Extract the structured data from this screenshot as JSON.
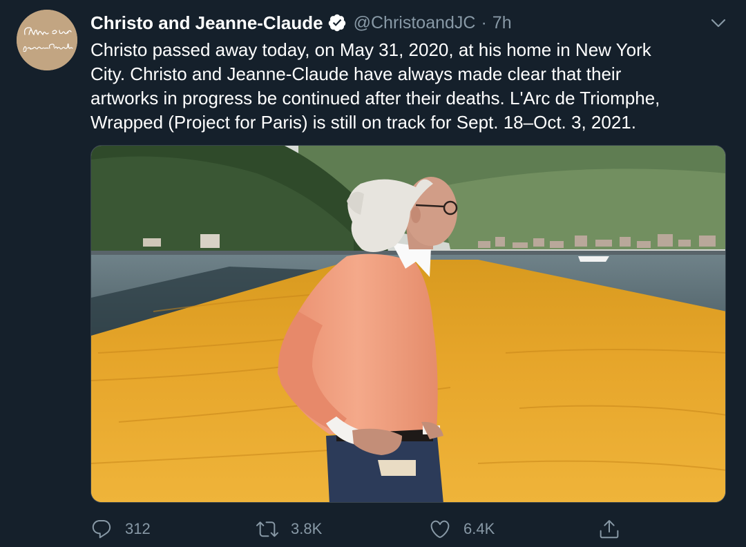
{
  "tweet": {
    "author": {
      "display_name": "Christo and Jeanne-Claude",
      "handle": "@ChristoandJC",
      "verified": true,
      "avatar_signature": "Christo and Jeanne-Claude"
    },
    "separator": "·",
    "timestamp": "7h",
    "text_lines": [
      "Christo passed away today, on May 31, 2020, at his home in New York",
      "City. Christo and Jeanne-Claude have always made clear that their",
      "artworks in progress be continued after their deaths. L'Arc de Triomphe,",
      "Wrapped (Project for Paris) is still on track for Sept. 18–Oct. 3, 2021."
    ],
    "actions": {
      "replies": "312",
      "retweets": "3.8K",
      "likes": "6.4K"
    }
  },
  "colors": {
    "background": "#15202b",
    "secondary_text": "#8899a6",
    "verified_badge": "#ffffff",
    "avatar_background": "#c2a582"
  },
  "icons": {
    "reply": "speech-bubble-icon",
    "retweet": "retweet-arrows-icon",
    "like": "heart-outline-icon",
    "share": "share-upload-icon",
    "menu": "chevron-down-icon",
    "verified": "verified-badge-icon"
  }
}
